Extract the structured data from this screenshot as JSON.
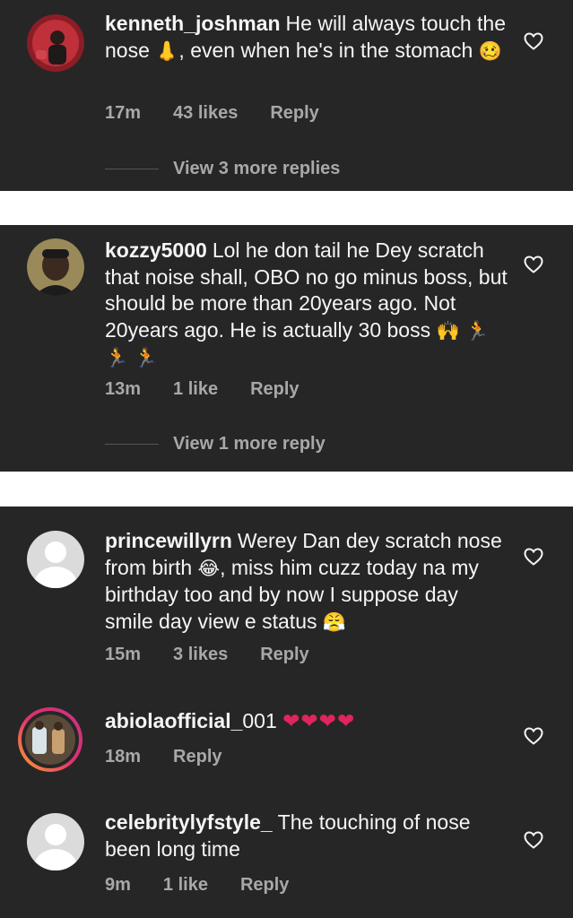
{
  "comments": [
    {
      "username": "kenneth_joshman",
      "text_before": "He will always touch the nose",
      "emoji1": "👃",
      "text_after": ", even when he's in the stomach",
      "emoji2": "🥴",
      "time": "17m",
      "likes": "43 likes",
      "reply": "Reply",
      "view_more": "View 3 more replies"
    },
    {
      "username": "kozzy5000",
      "text": "Lol he don tail he Dey scratch that noise shall, OBO no go minus boss, but should be more than 20years ago. Not 20years ago. He is actually 30 boss",
      "emoji": "🙌 🏃 🏃 🏃",
      "time": "13m",
      "likes": "1 like",
      "reply": "Reply",
      "view_more": "View 1 more reply"
    },
    {
      "username": "princewillyrn",
      "text_before": "Werey Dan dey scratch nose from birth",
      "emoji1": "😂",
      "text_after": ", miss him cuzz today na my birthday too and by now I suppose day smile day view e status",
      "emoji2": "😤",
      "time": "15m",
      "likes": "3 likes",
      "reply": "Reply"
    },
    {
      "username": "abiolaofficial_",
      "text": "001",
      "emoji": "❤❤❤❤",
      "time": "18m",
      "reply": "Reply"
    },
    {
      "username": "celebritylyfstyle_",
      "text": "The touching of nose been long time",
      "time": "9m",
      "likes": "1 like",
      "reply": "Reply"
    }
  ],
  "icons": {
    "like": "heart-outline-icon"
  },
  "colors": {
    "background": "#262626",
    "text": "#f5f5f5",
    "secondary": "#a8a8a8",
    "heart": "#e0245e"
  }
}
